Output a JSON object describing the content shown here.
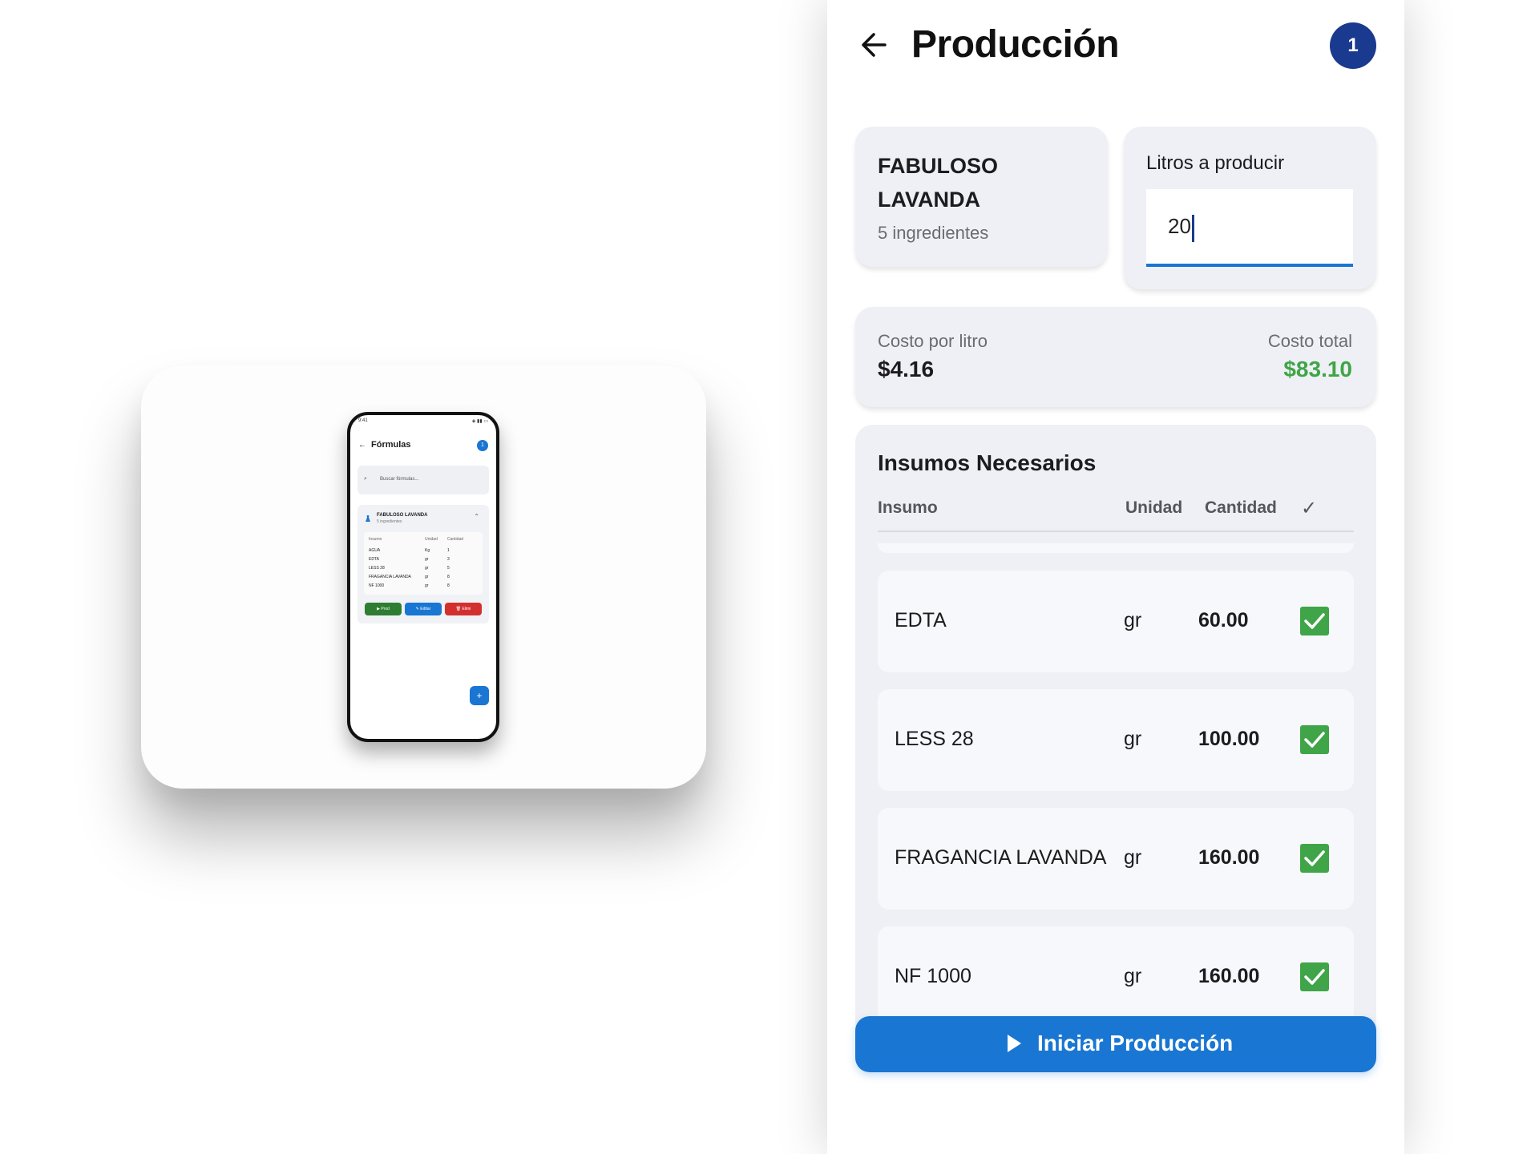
{
  "preview": {
    "status_time": "9:41",
    "status_icons": "◈ ▮▮ ▭",
    "title": "Fórmulas",
    "badge": "1",
    "search_placeholder": "Buscar fórmulas...",
    "card": {
      "title": "FABULOSO LAVANDA",
      "subtitle": "5 ingredientes",
      "headers": [
        "Insumo",
        "Unidad",
        "Cantidad"
      ],
      "rows": [
        {
          "name": "AGUA",
          "unit": "Kg",
          "qty": "1"
        },
        {
          "name": "EDTA",
          "unit": "gr",
          "qty": "3"
        },
        {
          "name": "LESS 28",
          "unit": "gr",
          "qty": "5"
        },
        {
          "name": "FRAGANCIA LAVANDA",
          "unit": "gr",
          "qty": "8"
        },
        {
          "name": "NF 1000",
          "unit": "gr",
          "qty": "8"
        }
      ],
      "buttons": {
        "prod": "▶ Prod",
        "edit": "✎ Editar",
        "delete": "🗑 Elimi"
      }
    },
    "fab": "+"
  },
  "header": {
    "title": "Producción",
    "badge": "1"
  },
  "formula": {
    "name": "FABULOSO LAVANDA",
    "ingredients": "5 ingredientes"
  },
  "liters": {
    "label": "Litros a producir",
    "value": "20"
  },
  "costs": {
    "per_liter_label": "Costo por litro",
    "per_liter_value": "$4.16",
    "total_label": "Costo total",
    "total_value": "$83.10"
  },
  "supplies": {
    "title": "Insumos Necesarios",
    "headers": {
      "insumo": "Insumo",
      "unidad": "Unidad",
      "cantidad": "Cantidad",
      "check": "✓"
    },
    "rows": [
      {
        "name": "EDTA",
        "unit": "gr",
        "qty": "60.00",
        "checked": true
      },
      {
        "name": "LESS 28",
        "unit": "gr",
        "qty": "100.00",
        "checked": true
      },
      {
        "name": "FRAGANCIA LAVANDA",
        "unit": "gr",
        "qty": "160.00",
        "checked": true
      },
      {
        "name": "NF 1000",
        "unit": "gr",
        "qty": "160.00",
        "checked": true
      }
    ]
  },
  "action": {
    "start_label": "Iniciar Producción"
  },
  "colors": {
    "primary": "#1976d2",
    "badge": "#1a3a8f",
    "success": "#3fa548",
    "card": "#eff0f5"
  }
}
